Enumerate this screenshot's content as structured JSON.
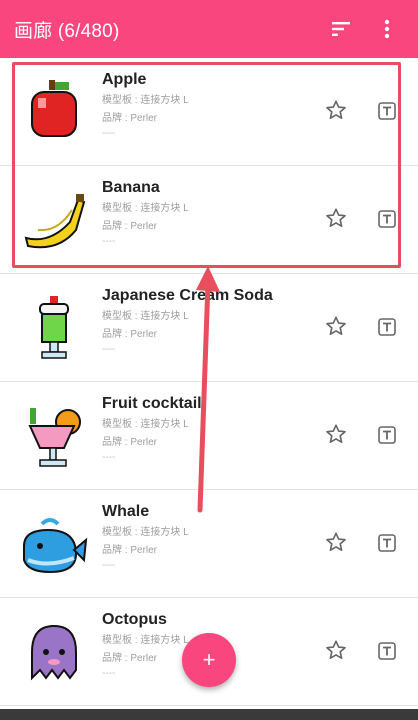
{
  "app": {
    "title": "画廊 (6/480)",
    "accent": "#f9467f",
    "sort_icon": "sort-icon",
    "menu_icon": "more-vert-icon"
  },
  "items": [
    {
      "name": "Apple",
      "board": "模型板 : 连接方块 L",
      "brand": "品牌 : Perler",
      "extra": "----",
      "thumb_icon": "apple-bead-icon"
    },
    {
      "name": "Banana",
      "board": "模型板 : 连接方块 L",
      "brand": "品牌 : Perler",
      "extra": "----",
      "thumb_icon": "banana-bead-icon"
    },
    {
      "name": "Japanese Cream Soda",
      "board": "模型板 : 连接方块 L",
      "brand": "品牌 : Perler",
      "extra": "----",
      "thumb_icon": "cream-soda-bead-icon"
    },
    {
      "name": "Fruit cocktail",
      "board": "模型板 : 连接方块 L",
      "brand": "品牌 : Perler",
      "extra": "----",
      "thumb_icon": "cocktail-bead-icon"
    },
    {
      "name": "Whale",
      "board": "模型板 : 连接方块 L",
      "brand": "品牌 : Perler",
      "extra": "----",
      "thumb_icon": "whale-bead-icon"
    },
    {
      "name": "Octopus",
      "board": "模型板 : 连接方块 L",
      "brand": "品牌 : Perler",
      "extra": "----",
      "thumb_icon": "octopus-bead-icon"
    }
  ],
  "fab": {
    "label": "+",
    "icon": "add-icon"
  }
}
